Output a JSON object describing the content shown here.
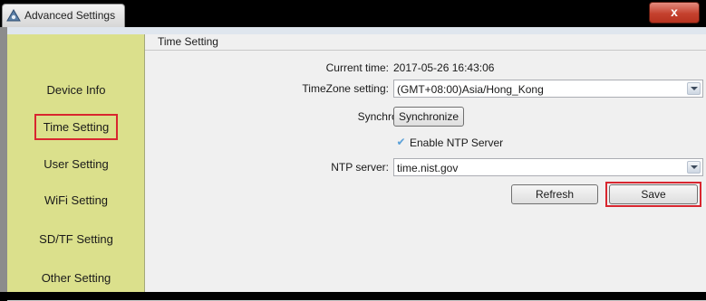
{
  "window": {
    "title": "Advanced Settings",
    "close_glyph": "x",
    "icons": {
      "app": "app-gear-icon",
      "close": "close-icon"
    }
  },
  "sidebar": {
    "items": [
      {
        "label": "Device Info",
        "selected": false
      },
      {
        "label": "Time Setting",
        "selected": true
      },
      {
        "label": "User Setting",
        "selected": false
      },
      {
        "label": "WiFi Setting",
        "selected": false
      },
      {
        "label": "SD/TF Setting",
        "selected": false
      },
      {
        "label": "Other Setting",
        "selected": false
      }
    ]
  },
  "main": {
    "group_title": "Time Setting",
    "current_time": {
      "label": "Current time:",
      "value": "2017-05-26 16:43:06"
    },
    "timezone": {
      "label": "TimeZone setting:",
      "value": "(GMT+08:00)Asia/Hong_Kong"
    },
    "sync_pc": {
      "label": "Synchronize with PC :",
      "button": "Synchronize"
    },
    "ntp_enable": {
      "label": "Enable NTP Server",
      "checked": true,
      "check_glyph": "✔"
    },
    "ntp_server": {
      "label": "NTP server:",
      "value": "time.nist.gov"
    },
    "refresh_label": "Refresh",
    "save_label": "Save"
  },
  "colors": {
    "sidebar_bg": "#dbe08c",
    "highlight_red": "#d8262f",
    "close_button": "#c5412e"
  }
}
